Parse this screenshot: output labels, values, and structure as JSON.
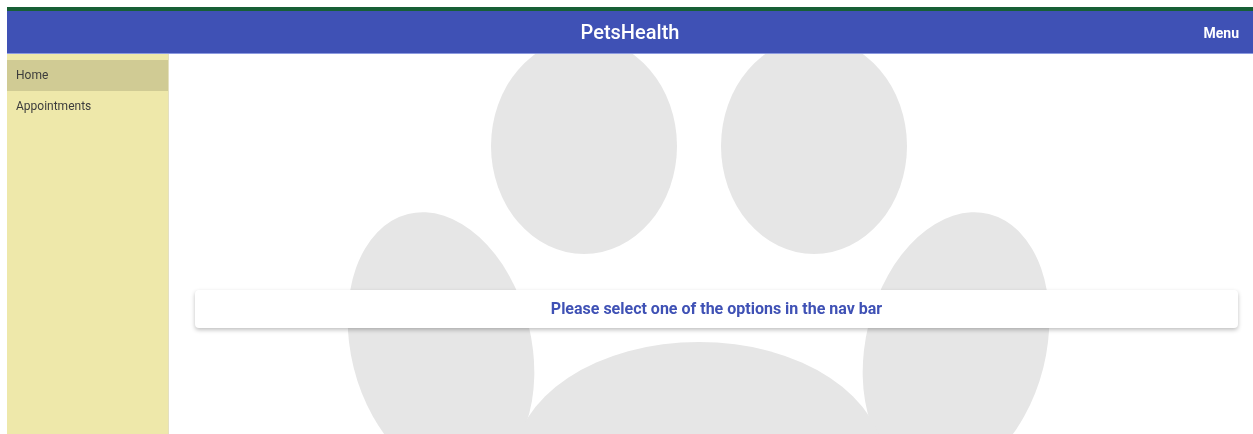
{
  "header": {
    "title": "PetsHealth",
    "menu": "Menu"
  },
  "sidebar": {
    "items": [
      {
        "label": "Home",
        "selected": true
      },
      {
        "label": "Appointments",
        "selected": false
      }
    ]
  },
  "message": "Please select one of the options in the nav bar"
}
